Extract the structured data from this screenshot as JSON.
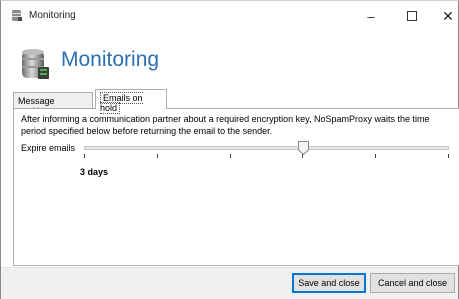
{
  "window": {
    "title": "Monitoring",
    "minimize": "–",
    "close": "✕"
  },
  "header": {
    "title": "Monitoring"
  },
  "tabs": [
    {
      "label": "Message tracking",
      "selected": false
    },
    {
      "label": "Emails on hold",
      "selected": true
    }
  ],
  "content": {
    "description": "After informing a communication partner about a required encryption key, NoSpamProxy waits the time period specified below before returning the email to the sender.",
    "expire_label": "Expire emails",
    "slider_value_label": "3 days",
    "slider_position": 0.6
  },
  "footer": {
    "save_label": "Save and close",
    "cancel_label": "Cancel and close"
  },
  "colors": {
    "header_title": "#2b6fb1",
    "default_button_border": "#0078d7"
  }
}
